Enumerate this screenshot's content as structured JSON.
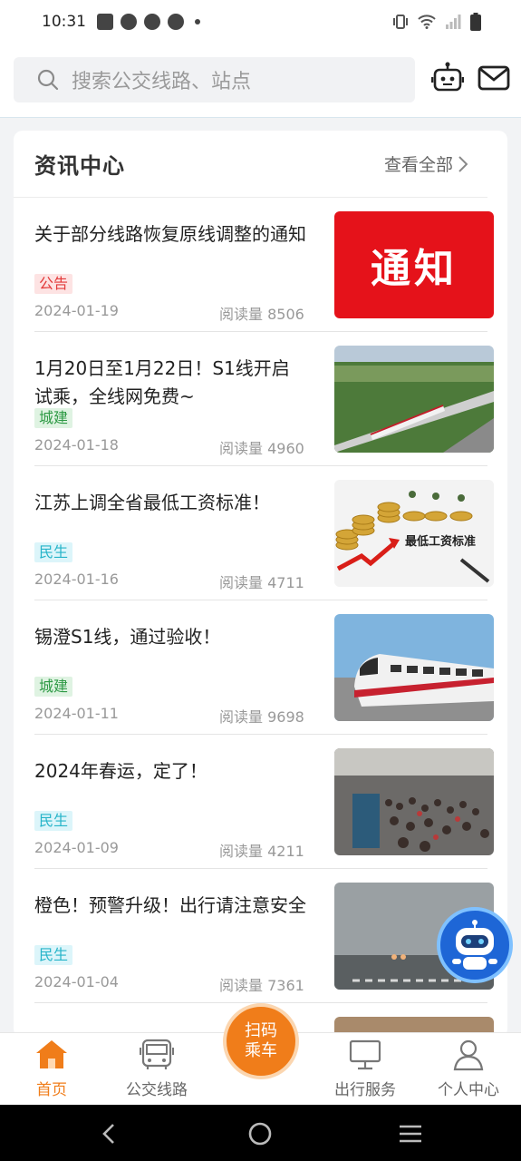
{
  "status_bar": {
    "time": "10:31"
  },
  "search": {
    "placeholder": "搜索公交线路、站点"
  },
  "news_center": {
    "title": "资讯中心",
    "view_all": "查看全部",
    "items": [
      {
        "title": "关于部分线路恢复原线调整的通知",
        "tag": "公告",
        "date": "2024-01-19",
        "reads": "阅读量 8506",
        "thumb_text": "通知"
      },
      {
        "title": "1月20日至1月22日！S1线开启试乘，全线网免费~",
        "tag": "城建",
        "date": "2024-01-18",
        "reads": "阅读量 4960"
      },
      {
        "title": "江苏上调全省最低工资标准！",
        "tag": "民生",
        "date": "2024-01-16",
        "reads": "阅读量 4711",
        "thumb_text": "最低工资标准"
      },
      {
        "title": "锡澄S1线，通过验收！",
        "tag": "城建",
        "date": "2024-01-11",
        "reads": "阅读量 9698"
      },
      {
        "title": "2024年春运，定了！",
        "tag": "民生",
        "date": "2024-01-09",
        "reads": "阅读量 4211"
      },
      {
        "title": "橙色！预警升级！出行请注意安全",
        "tag": "民生",
        "date": "2024-01-04",
        "reads": "阅读量 7361"
      }
    ]
  },
  "tabbar": {
    "home": "首页",
    "bus_lines": "公交线路",
    "scan_line1": "扫码",
    "scan_line2": "乘车",
    "travel_service": "出行服务",
    "personal_center": "个人中心"
  },
  "colors": {
    "accent": "#f07d1a",
    "tag_notice": "#e33a3a",
    "tag_construction": "#2e9a45",
    "tag_livelihood": "#26b4c9"
  }
}
